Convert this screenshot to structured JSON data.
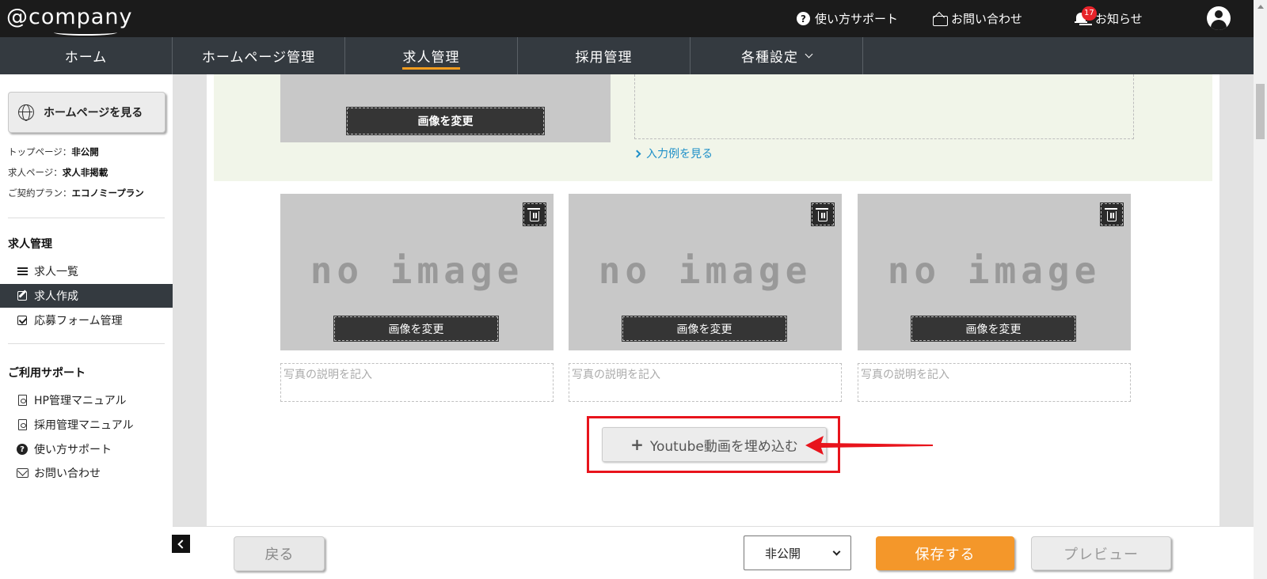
{
  "header": {
    "logo_text": "@company",
    "support": "使い方サポート",
    "contact": "お問い合わせ",
    "notifications": "お知らせ",
    "notification_count": "17"
  },
  "nav": {
    "tabs": [
      "ホーム",
      "ホームページ管理",
      "求人管理",
      "採用管理",
      "各種設定"
    ],
    "active": "求人管理"
  },
  "sidebar": {
    "view_site": "ホームページを見る",
    "status": {
      "top_label": "トップページ：",
      "top_value": "非公開",
      "job_label": "求人ページ：",
      "job_value": "求人非掲載",
      "plan_label": "ご契約プラン：",
      "plan_value": "エコノミープラン"
    },
    "section1_title": "求人管理",
    "section1_items": [
      "求人一覧",
      "求人作成",
      "応募フォーム管理"
    ],
    "section2_title": "ご利用サポート",
    "section2_items": [
      "HP管理マニュアル",
      "採用管理マニュアル",
      "使い方サポート",
      "お問い合わせ"
    ]
  },
  "editor": {
    "change_image": "画像を変更",
    "example_link": "入力例を見る",
    "no_image": "no image",
    "caption_placeholder": "写真の説明を記入",
    "youtube_button": "Youtube動画を埋め込む"
  },
  "footer": {
    "back": "戻る",
    "status_value": "非公開",
    "save": "保存する",
    "preview": "プレビュー"
  },
  "colors": {
    "topbar": "#1b1b1b",
    "nav": "#343a40",
    "accent": "#f39c1f",
    "save": "#f4972a",
    "highlight": "#e8141c",
    "link": "#1d8fc8"
  }
}
